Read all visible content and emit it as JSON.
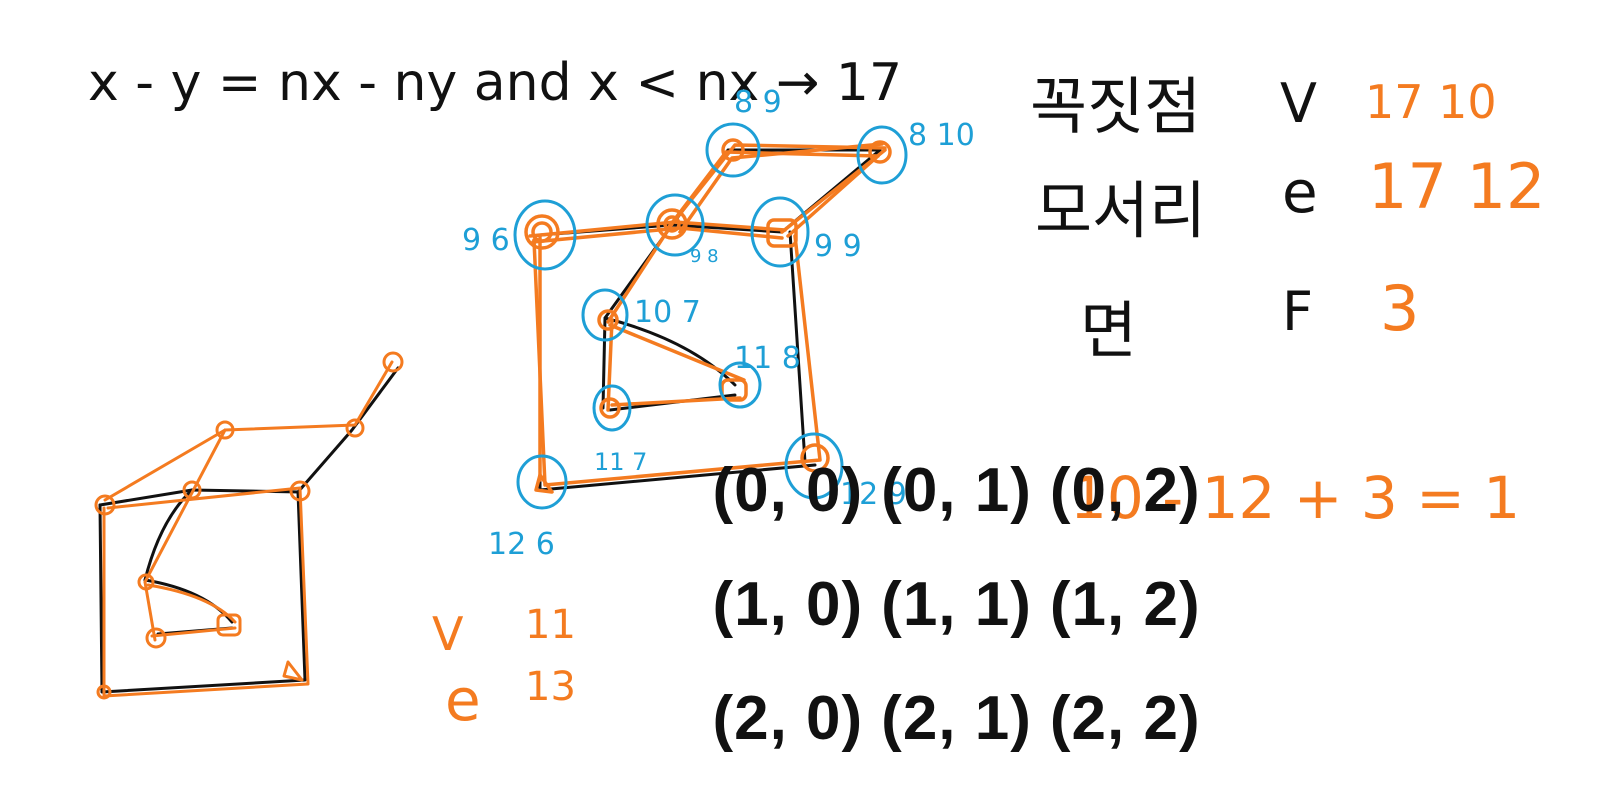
{
  "colors": {
    "ink_black": "#111111",
    "ink_orange": "#f47b20",
    "ink_blue": "#1e9fd6",
    "background": "#ffffff"
  },
  "equation": "x - y = nx - ny  and  x < nx → 17",
  "legend": {
    "vertex": {
      "korean": "꼭짓점",
      "symbol": "V",
      "values": "17  10"
    },
    "edge": {
      "korean": "모서리",
      "symbol": "e",
      "values": "17  12"
    },
    "face": {
      "korean": "면",
      "symbol": "F",
      "values": "3"
    }
  },
  "euler_note": "10 - 12 + 3 = 1",
  "small_counts": {
    "v_label": "V",
    "v_value": "11",
    "e_label": "e",
    "e_value": "13"
  },
  "node_labels": [
    {
      "text": "8 9"
    },
    {
      "text": "8 10"
    },
    {
      "text": "9 6"
    },
    {
      "text": "9 8"
    },
    {
      "text": "9 9"
    },
    {
      "text": "10 7"
    },
    {
      "text": "11 8"
    },
    {
      "text": "11 7"
    },
    {
      "text": "12 9"
    },
    {
      "text": "12 6"
    }
  ],
  "grid_cells": [
    [
      "(0, 0)",
      "(0, 1)",
      "(0, 2)"
    ],
    [
      "(1, 0)",
      "(1, 1)",
      "(1, 2)"
    ],
    [
      "(2, 0)",
      "(2, 1)",
      "(2, 2)"
    ]
  ]
}
